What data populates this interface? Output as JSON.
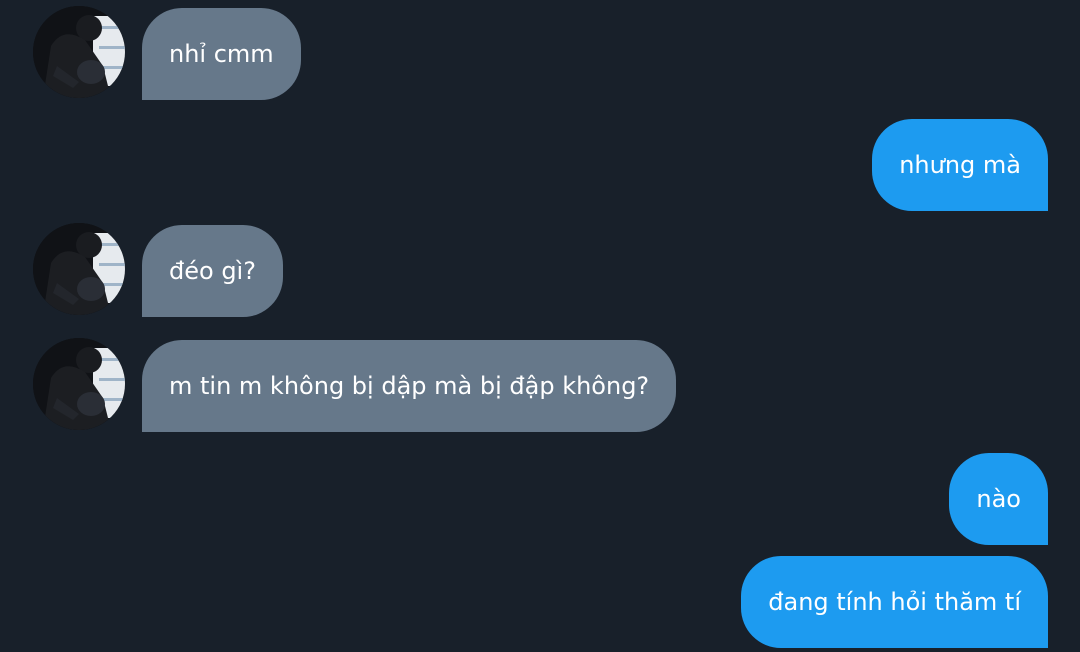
{
  "avatar_icon": "user-avatar-photo",
  "colors": {
    "background": "#18202a",
    "incoming_bubble": "#66788a",
    "outgoing_bubble": "#1d9bf0",
    "text": "#ffffff"
  },
  "messages": [
    {
      "direction": "incoming",
      "text": "nhỉ cmm"
    },
    {
      "direction": "outgoing",
      "text": "nhưng mà"
    },
    {
      "direction": "incoming",
      "text": "đéo gì?"
    },
    {
      "direction": "incoming",
      "text": "m tin m không bị dập mà bị đập không?"
    },
    {
      "direction": "outgoing",
      "text": "nào"
    },
    {
      "direction": "outgoing",
      "text": "đang tính hỏi thăm tí"
    }
  ]
}
